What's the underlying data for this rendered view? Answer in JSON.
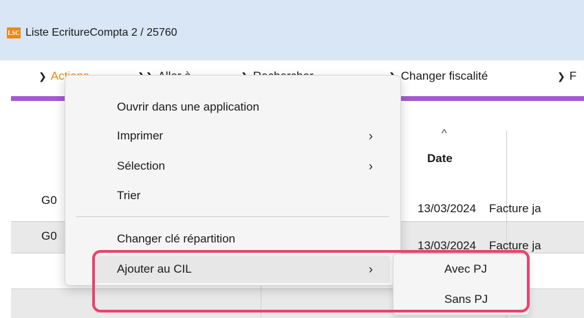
{
  "window": {
    "logo_text": "LSC",
    "title": "Liste  EcritureCompta 2 / 25760"
  },
  "toolbar": {
    "items": [
      {
        "label": "Actions",
        "icon": "chevron-down-icon"
      },
      {
        "label": "Aller à",
        "icon": "chevron-right-icon"
      },
      {
        "label": "Rechercher",
        "icon": "chevron-right-icon"
      },
      {
        "label": "Changer fiscalité",
        "icon": "chevron-right-icon"
      },
      {
        "label": "F",
        "icon": "chevron-right-icon"
      }
    ]
  },
  "grid": {
    "sort_glyph": "^",
    "columns": {
      "date": "Date"
    },
    "rows": [
      {
        "code": "G0",
        "date": "13/03/2024",
        "label": "Facture ja"
      },
      {
        "code": "G0",
        "date": "13/03/2024",
        "label": "Facture ja"
      }
    ]
  },
  "context_menu": {
    "items": [
      {
        "label": "Ouvrir dans une application",
        "has_submenu": false
      },
      {
        "label": "Imprimer",
        "has_submenu": true
      },
      {
        "label": "Sélection",
        "has_submenu": true
      },
      {
        "label": "Trier",
        "has_submenu": false
      },
      {
        "label": "Changer clé répartition",
        "has_submenu": false
      },
      {
        "label": "Ajouter au CIL",
        "has_submenu": true
      }
    ],
    "arrow_glyph": "›"
  },
  "submenu": {
    "items": [
      {
        "label": "Avec PJ"
      },
      {
        "label": "Sans PJ"
      }
    ]
  },
  "colors": {
    "accent_bar": "#a45ad3",
    "callout": "#e8446e",
    "titlebar": "#d8e6f5",
    "logo": "#e8891b"
  }
}
